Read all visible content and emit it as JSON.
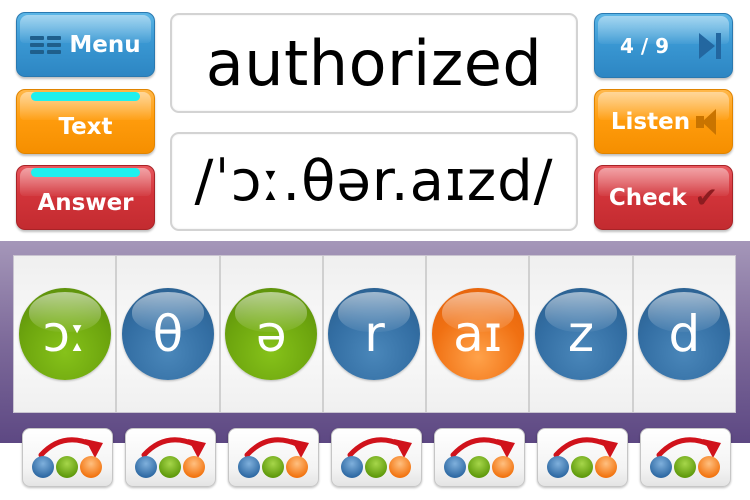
{
  "left_buttons": {
    "menu": {
      "label": "Menu",
      "icon": "menu-grid-icon"
    },
    "text": {
      "label": "Text"
    },
    "answer": {
      "label": "Answer"
    }
  },
  "right_buttons": {
    "progress": {
      "label": "4 / 9",
      "current": 4,
      "total": 9,
      "icon": "next-track-icon"
    },
    "listen": {
      "label": "Listen",
      "icon": "speaker-icon"
    },
    "check": {
      "label": "Check",
      "icon": "checkmark-icon"
    }
  },
  "word": {
    "text": "authorized"
  },
  "ipa": {
    "text": "/ˈɔː.θər.aɪzd/"
  },
  "phonemes": [
    {
      "symbol": "ɔː",
      "color": "green"
    },
    {
      "symbol": "θ",
      "color": "blue"
    },
    {
      "symbol": "ə",
      "color": "green"
    },
    {
      "symbol": "r",
      "color": "blue"
    },
    {
      "symbol": "aɪ",
      "color": "orange"
    },
    {
      "symbol": "z",
      "color": "blue"
    },
    {
      "symbol": "d",
      "color": "blue"
    }
  ],
  "reorder_buttons": {
    "count": 7,
    "icon": "reorder-arrow-icon"
  },
  "colors": {
    "blue": "#3a98d3",
    "orange": "#ff9c0d",
    "red": "#d2343a",
    "cyan": "#1ff0ee",
    "panel_purple": "#7d6a9a",
    "orb_green": "#6da50e",
    "orb_blue": "#336ea3",
    "orb_orange": "#f07012"
  }
}
